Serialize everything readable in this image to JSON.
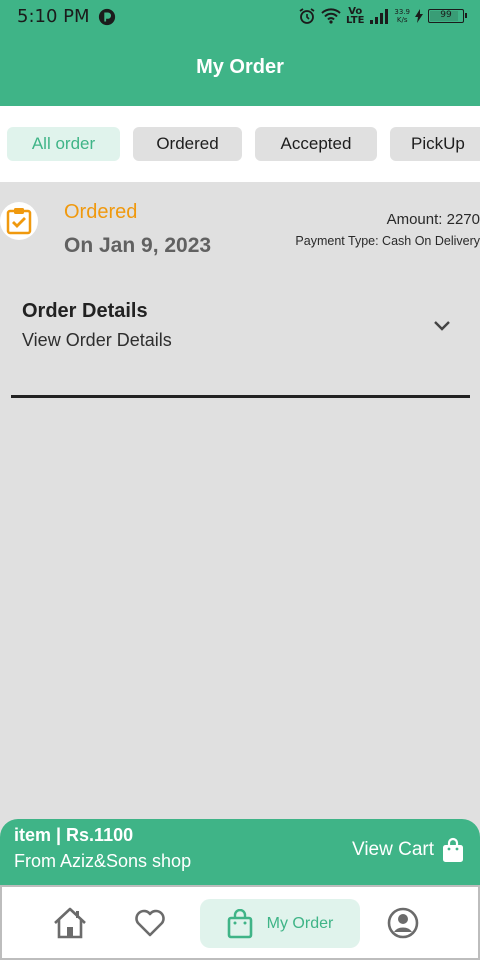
{
  "status_bar": {
    "time": "5:10 PM",
    "network_line1": "Vo",
    "network_line2": "LTE",
    "speed_value": "33.9",
    "speed_unit": "K/s",
    "battery": "99"
  },
  "header": {
    "title": "My Order"
  },
  "tabs": [
    {
      "label": "All order",
      "active": true
    },
    {
      "label": "Ordered",
      "active": false
    },
    {
      "label": "Accepted",
      "active": false
    },
    {
      "label": "PickUp",
      "active": false
    }
  ],
  "order": {
    "status": "Ordered",
    "date": "On Jan 9, 2023",
    "amount": "Amount: 2270",
    "payment": "Payment Type: Cash On Delivery",
    "details_title": "Order Details",
    "details_link": "View Order Details"
  },
  "cart": {
    "item_summary": "item | Rs.1100",
    "shop": "From Aziz&Sons shop",
    "view_cart_label": "View Cart"
  },
  "bottom_nav": {
    "items": [
      {
        "icon": "home-icon"
      },
      {
        "icon": "heart-icon"
      },
      {
        "icon": "shopping-bag-icon",
        "label": "My Order",
        "active": true
      },
      {
        "icon": "profile-icon"
      }
    ]
  },
  "colors": {
    "primary": "#3fb487",
    "status_ordered": "#f0990e",
    "active_tab_bg": "#e0f3ec"
  }
}
